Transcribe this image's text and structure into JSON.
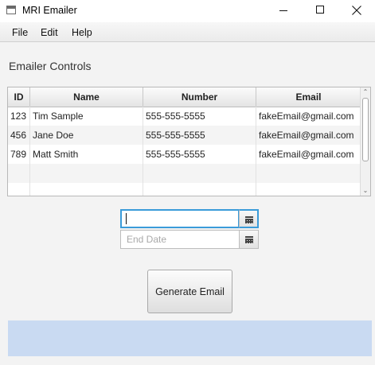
{
  "window": {
    "title": "MRI Emailer"
  },
  "menu": {
    "file": "File",
    "edit": "Edit",
    "help": "Help"
  },
  "section": {
    "title": "Emailer Controls"
  },
  "table": {
    "headers": [
      "ID",
      "Name",
      "Number",
      "Email"
    ],
    "rows": [
      [
        "123",
        "Tim Sample",
        "555-555-5555",
        "fakeEmail@gmail.com"
      ],
      [
        "456",
        "Jane Doe",
        "555-555-5555",
        "fakeEmail@gmail.com"
      ],
      [
        "789",
        "Matt Smith",
        "555-555-5555",
        "fakeEmail@gmail.com"
      ],
      [
        "",
        "",
        "",
        ""
      ],
      [
        "",
        "",
        "",
        ""
      ]
    ]
  },
  "start_date": {
    "value": "",
    "placeholder": ""
  },
  "end_date": {
    "value": "",
    "placeholder": "End Date"
  },
  "buttons": {
    "generate": "Generate Email"
  },
  "colors": {
    "accent": "#3a9bd9",
    "status_bar": "#c9daf2"
  }
}
